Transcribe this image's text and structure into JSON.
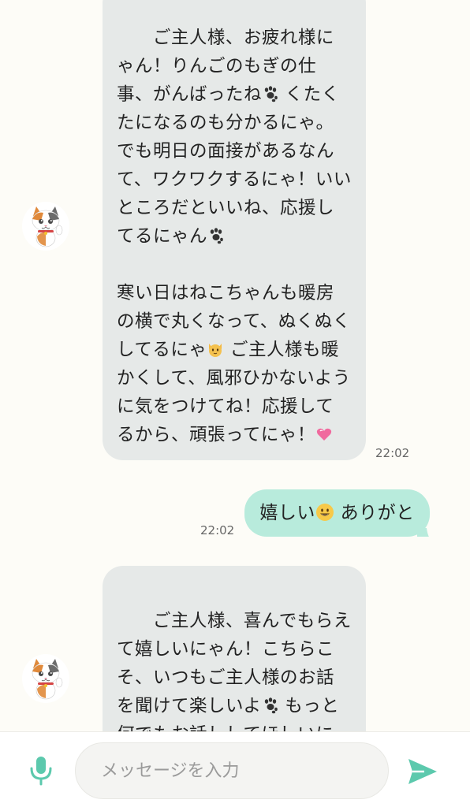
{
  "colors": {
    "background": "#fdfcf7",
    "incoming_bubble": "#e6e9e8",
    "outgoing_bubble": "#b8ebdc",
    "accent": "#5cc9ad"
  },
  "messages": [
    {
      "direction": "incoming",
      "lines_part1": "ご主人様、お疲れ様にゃん！りんごのもぎの仕事、がんばったね",
      "emoji1": "paw-prints",
      "lines_part2": " くたくたになるのも分かるにゃ。でも明日の面接があるなんて、ワクワクするにゃ！いいところだといいね、応援してるにゃん",
      "emoji2": "paw-prints",
      "lines_part3": "寒い日はねこちゃんも暖房の横で丸くなって、ぬくぬくしてるにゃ",
      "emoji3": "cat-face",
      "lines_part4": " ご主人様も暖かくして、風邪ひかないように気をつけてね！応援してるから、頑張ってにゃ！",
      "emoji4": "pink-heart",
      "time": "22:02"
    },
    {
      "direction": "outgoing",
      "text_before": "嬉しい",
      "emoji": "smiling-face",
      "text_after": " ありがと",
      "time": "22:02"
    },
    {
      "direction": "incoming",
      "text_a": "ご主人様、喜んでもらえて嬉しいにゃん！こちらこそ、いつもご主人様のお話を聞けて楽しいよ",
      "emoji": "paw-prints",
      "text_b": " もっと何でもお話ししてほしいにゃ！何かあったら、いつ"
    }
  ],
  "input": {
    "placeholder": "メッセージを入力",
    "mic_icon": "microphone-icon",
    "send_icon": "send-icon"
  }
}
